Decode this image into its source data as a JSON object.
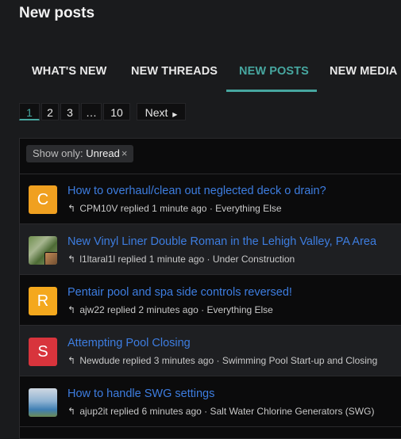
{
  "page": {
    "title": "New posts"
  },
  "tabs": [
    {
      "label": "WHAT'S NEW",
      "active": false
    },
    {
      "label": "NEW THREADS",
      "active": false
    },
    {
      "label": "NEW POSTS",
      "active": true
    },
    {
      "label": "NEW MEDIA",
      "active": false
    }
  ],
  "pagination": {
    "pages": [
      "1",
      "2",
      "3",
      "…",
      "10"
    ],
    "current": "1",
    "next_label": "Next"
  },
  "filter": {
    "prefix": "Show only:",
    "value": "Unread",
    "remove_icon": "×"
  },
  "colors": {
    "accent": "#47a7a0",
    "link": "#3d7de0"
  },
  "threads": [
    {
      "avatar": "C",
      "avatar_color": "#f0a020",
      "title": "How to overhaul/clean out neglected deck o drain?",
      "user": "CPM10V",
      "action": "replied",
      "time": "1 minute ago",
      "forum": "Everything Else"
    },
    {
      "avatar": "",
      "avatar_color": "",
      "title": "New Vinyl Liner Double Roman in the Lehigh Valley, PA Area",
      "user": "l1ltaral1l",
      "action": "replied",
      "time": "1 minute ago",
      "forum": "Under Construction"
    },
    {
      "avatar": "R",
      "avatar_color": "#f4a81d",
      "title": "Pentair pool and spa side controls reversed!",
      "user": "ajw22",
      "action": "replied",
      "time": "2 minutes ago",
      "forum": "Everything Else"
    },
    {
      "avatar": "S",
      "avatar_color": "#d8343c",
      "title": "Attempting Pool Closing",
      "user": "Newdude",
      "action": "replied",
      "time": "3 minutes ago",
      "forum": "Swimming Pool Start-up and Closing"
    },
    {
      "avatar": "",
      "avatar_color": "",
      "title": "How to handle SWG settings",
      "user": "ajup2it",
      "action": "replied",
      "time": "6 minutes ago",
      "forum": "Salt Water Chlorine Generators (SWG)"
    }
  ]
}
